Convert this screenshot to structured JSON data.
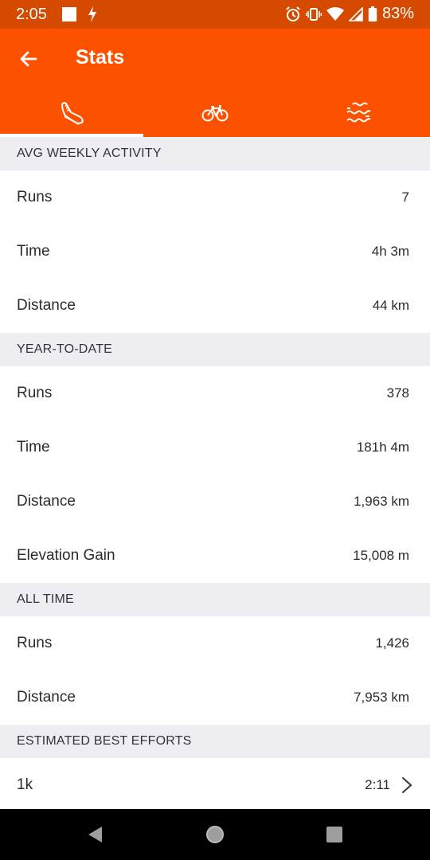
{
  "status_bar": {
    "time": "2:05",
    "battery": "83%"
  },
  "app_bar": {
    "title": "Stats",
    "back_icon": "arrow-left-icon"
  },
  "tabs": [
    {
      "icon": "running-shoe-icon",
      "active": true
    },
    {
      "icon": "bicycle-icon",
      "active": false
    },
    {
      "icon": "swim-waves-icon",
      "active": false
    }
  ],
  "sections": {
    "avg_weekly": {
      "header": "AVG WEEKLY ACTIVITY",
      "rows": [
        {
          "label": "Runs",
          "value": "7"
        },
        {
          "label": "Time",
          "value": "4h 3m"
        },
        {
          "label": "Distance",
          "value": "44 km"
        }
      ]
    },
    "ytd": {
      "header": "YEAR-TO-DATE",
      "rows": [
        {
          "label": "Runs",
          "value": "378"
        },
        {
          "label": "Time",
          "value": "181h 4m"
        },
        {
          "label": "Distance",
          "value": "1,963 km"
        },
        {
          "label": "Elevation Gain",
          "value": "15,008 m"
        }
      ]
    },
    "all_time": {
      "header": "ALL TIME",
      "rows": [
        {
          "label": "Runs",
          "value": "1,426"
        },
        {
          "label": "Distance",
          "value": "7,953 km"
        }
      ]
    },
    "best_efforts": {
      "header": "ESTIMATED BEST EFFORTS",
      "rows": [
        {
          "label": "1k",
          "value": "2:11"
        }
      ]
    }
  },
  "colors": {
    "brand": "#fc5200",
    "status_bar": "#d64a00",
    "section_bg": "#eeeef2"
  }
}
